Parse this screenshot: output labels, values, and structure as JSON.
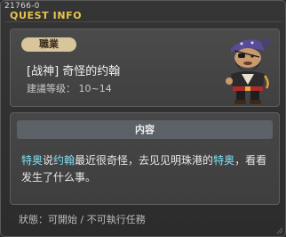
{
  "window": {
    "quest_id": "21766-0",
    "title": "QUEST INFO"
  },
  "info": {
    "job_badge": "職業",
    "quest_name": "[战神] 奇怪的约翰",
    "level_label": "建議等级：",
    "level_range": "10~14",
    "npc_portrait": "pirate-npc-icon"
  },
  "content": {
    "header": "内容",
    "desc": {
      "p1": "特奥",
      "p2": "说",
      "p3": "约翰",
      "p4": "最近很奇怪，去见见明珠港的",
      "p5": "特奥",
      "p6": "，看看发生了什么事。"
    }
  },
  "status": {
    "text": "狀態：可開始 / 不可執行任務"
  },
  "colors": {
    "title": "#e8c44a",
    "highlight": "#7fe0f2",
    "badge_bg": "#d8c59a"
  }
}
